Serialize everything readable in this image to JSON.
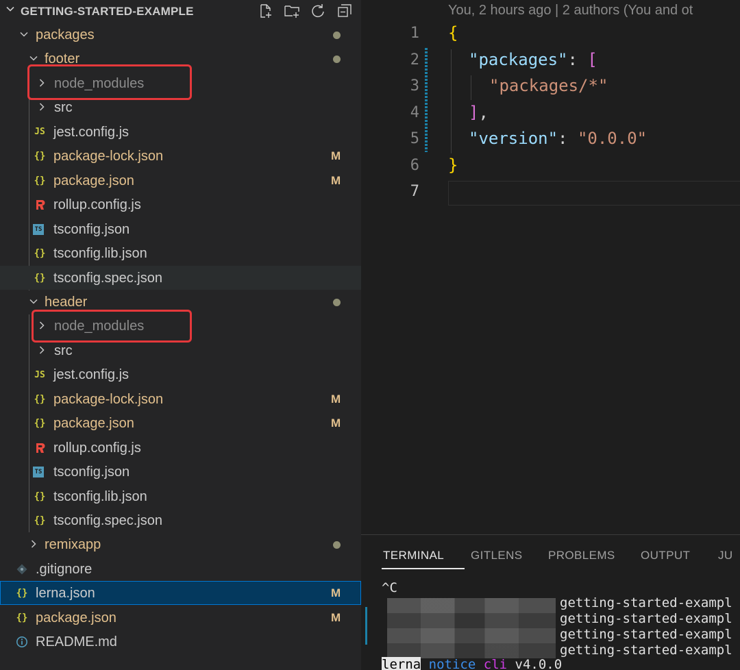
{
  "explorer": {
    "title": "GETTING-STARTED-EXAMPLE",
    "actions": [
      "new-file-icon",
      "new-folder-icon",
      "refresh-icon",
      "collapse-all-icon"
    ],
    "rows": [
      {
        "label": "packages",
        "kind": "folder-open",
        "color": "modified",
        "dot": true
      },
      {
        "label": "footer",
        "kind": "folder-open",
        "color": "modified",
        "dot": true
      },
      {
        "label": "node_modules",
        "kind": "folder",
        "color": "dimmed"
      },
      {
        "label": "src",
        "kind": "folder",
        "color": "plain"
      },
      {
        "label": "jest.config.js",
        "kind": "js",
        "color": "plain"
      },
      {
        "label": "package-lock.json",
        "kind": "json",
        "color": "modified",
        "badge": "M"
      },
      {
        "label": "package.json",
        "kind": "json",
        "color": "modified",
        "badge": "M"
      },
      {
        "label": "rollup.config.js",
        "kind": "rollup",
        "color": "plain"
      },
      {
        "label": "tsconfig.json",
        "kind": "ts",
        "color": "plain"
      },
      {
        "label": "tsconfig.lib.json",
        "kind": "json",
        "color": "plain"
      },
      {
        "label": "tsconfig.spec.json",
        "kind": "json",
        "color": "plain"
      },
      {
        "label": "header",
        "kind": "folder-open",
        "color": "modified",
        "dot": true
      },
      {
        "label": "node_modules",
        "kind": "folder",
        "color": "dimmed"
      },
      {
        "label": "src",
        "kind": "folder",
        "color": "plain"
      },
      {
        "label": "jest.config.js",
        "kind": "js",
        "color": "plain"
      },
      {
        "label": "package-lock.json",
        "kind": "json",
        "color": "modified",
        "badge": "M"
      },
      {
        "label": "package.json",
        "kind": "json",
        "color": "modified",
        "badge": "M"
      },
      {
        "label": "rollup.config.js",
        "kind": "rollup",
        "color": "plain"
      },
      {
        "label": "tsconfig.json",
        "kind": "ts",
        "color": "plain"
      },
      {
        "label": "tsconfig.lib.json",
        "kind": "json",
        "color": "plain"
      },
      {
        "label": "tsconfig.spec.json",
        "kind": "json",
        "color": "plain"
      },
      {
        "label": "remixapp",
        "kind": "folder",
        "color": "modified",
        "dot": true
      },
      {
        "label": ".gitignore",
        "kind": "git",
        "color": "plain"
      },
      {
        "label": "lerna.json",
        "kind": "json",
        "color": "plain",
        "badge": "M",
        "selected": true
      },
      {
        "label": "package.json",
        "kind": "json",
        "color": "modified",
        "badge": "M"
      },
      {
        "label": "README.md",
        "kind": "info",
        "color": "plain"
      }
    ],
    "icon_glyphs": {
      "js": "JS",
      "json": "{}",
      "ts": "TS"
    },
    "badge_color": "#e2c08d",
    "highlight_color": "#e5383b"
  },
  "editor": {
    "blame": "You, 2 hours ago | 2 authors (You and ot",
    "line_numbers": [
      "1",
      "2",
      "3",
      "4",
      "5",
      "6",
      "7"
    ],
    "code": {
      "l1_brace": "{",
      "l2_key": "\"packages\"",
      "l2_colon": ": ",
      "l2_bracket": "[",
      "l3_str": "\"packages/*\"",
      "l4_bracket": "]",
      "l4_comma": ",",
      "l5_key": "\"version\"",
      "l5_colon": ": ",
      "l5_str": "\"0.0.0\"",
      "l6_brace": "}"
    }
  },
  "panel": {
    "tabs": [
      "TERMINAL",
      "GITLENS",
      "PROBLEMS",
      "OUTPUT",
      "JU"
    ],
    "active_tab": "TERMINAL",
    "terminal": {
      "line1": "^C",
      "output_lines": [
        "getting-started-exampl",
        "getting-started-exampl",
        "getting-started-exampl",
        "getting-started-exampl"
      ],
      "last_line": {
        "lerna": "lerna",
        "notice": "notice",
        "cli": "cli",
        "version": " v4.0.0"
      }
    }
  }
}
